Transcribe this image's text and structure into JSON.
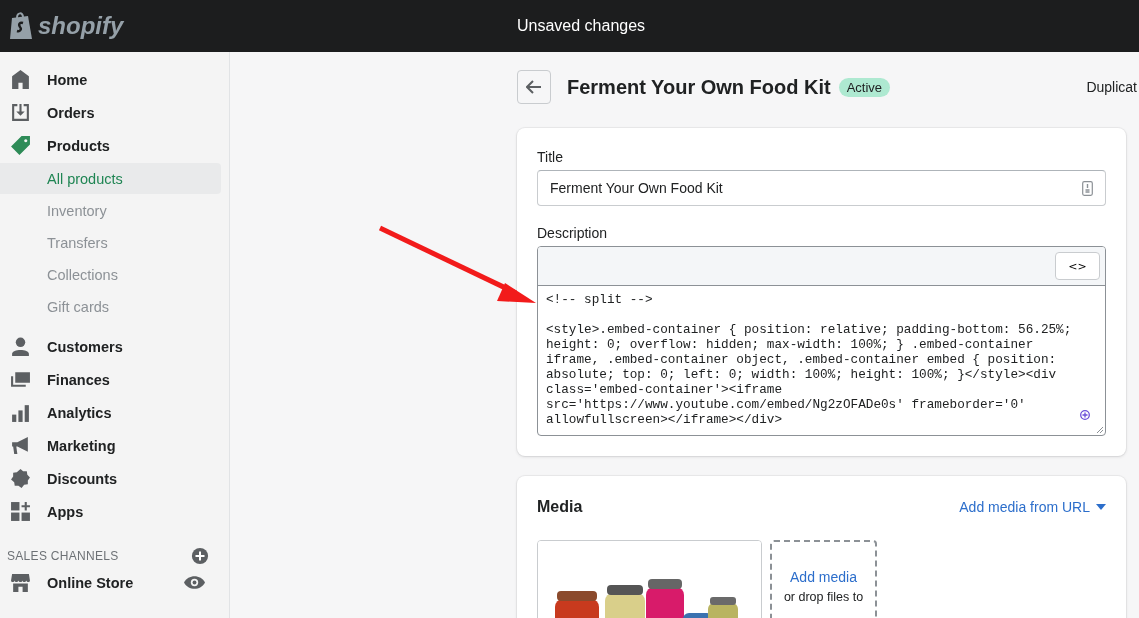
{
  "topbar": {
    "logo": "shopify",
    "status": "Unsaved changes"
  },
  "sidebar": {
    "items": [
      {
        "label": "Home",
        "kind": "home",
        "active": false
      },
      {
        "label": "Orders",
        "kind": "orders",
        "active": false
      },
      {
        "label": "Products",
        "kind": "tag",
        "active": true,
        "children": [
          {
            "label": "All products",
            "selected": true
          },
          {
            "label": "Inventory",
            "selected": false
          },
          {
            "label": "Transfers",
            "selected": false
          },
          {
            "label": "Collections",
            "selected": false
          },
          {
            "label": "Gift cards",
            "selected": false
          }
        ]
      },
      {
        "label": "Customers",
        "kind": "person",
        "active": false
      },
      {
        "label": "Finances",
        "kind": "finances",
        "active": false
      },
      {
        "label": "Analytics",
        "kind": "bars",
        "active": false
      },
      {
        "label": "Marketing",
        "kind": "megaphone",
        "active": false
      },
      {
        "label": "Discounts",
        "kind": "discount",
        "active": false
      },
      {
        "label": "Apps",
        "kind": "apps",
        "active": false
      }
    ],
    "section": "SALES CHANNELS",
    "channels": [
      {
        "label": "Online Store",
        "kind": "store"
      }
    ]
  },
  "page": {
    "title": "Ferment Your Own Food Kit",
    "status_badge": "Active",
    "action": "Duplicat"
  },
  "details": {
    "title_label": "Title",
    "title_value": "Ferment Your Own Food Kit",
    "description_label": "Description",
    "html_toggle": "<>",
    "description_html": "<!-- split -->\n\n<style>.embed-container { position: relative; padding-bottom: 56.25%;\nheight: 0; overflow: hidden; max-width: 100%; } .embed-container\niframe, .embed-container object, .embed-container embed { position:\nabsolute; top: 0; left: 0; width: 100%; height: 100%; }</style><div\nclass='embed-container'><iframe\nsrc='https://www.youtube.com/embed/Ng2zOFADe0s' frameborder='0'\nallowfullscreen></iframe></div>"
  },
  "media": {
    "heading": "Media",
    "add_from_url": "Add media from URL",
    "add_media": "Add media",
    "drop_hint": "or drop files to"
  }
}
